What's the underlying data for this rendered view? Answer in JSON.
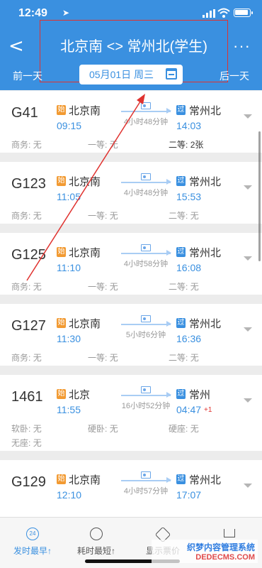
{
  "status": {
    "time": "12:49"
  },
  "header": {
    "title": "北京南 <> 常州北(学生)",
    "prev_day": "前一天",
    "next_day": "后一天",
    "date": "05月01日 周三",
    "back_glyph": "<",
    "more_glyph": "···"
  },
  "trains": [
    {
      "number": "G41",
      "from_badge": "始",
      "from": "北京南",
      "depart": "09:15",
      "duration": "4小时48分钟",
      "to_badge": "过",
      "to": "常州北",
      "arrive": "14:03",
      "plus_day": "",
      "seats": [
        {
          "label": "商务",
          "value": "无"
        },
        {
          "label": "一等",
          "value": "无"
        },
        {
          "label": "二等",
          "value": "2张"
        }
      ],
      "extra_seats": []
    },
    {
      "number": "G123",
      "from_badge": "始",
      "from": "北京南",
      "depart": "11:05",
      "duration": "4小时48分钟",
      "to_badge": "过",
      "to": "常州北",
      "arrive": "15:53",
      "plus_day": "",
      "seats": [
        {
          "label": "商务",
          "value": "无"
        },
        {
          "label": "一等",
          "value": "无"
        },
        {
          "label": "二等",
          "value": "无"
        }
      ],
      "extra_seats": []
    },
    {
      "number": "G125",
      "from_badge": "始",
      "from": "北京南",
      "depart": "11:10",
      "duration": "4小时58分钟",
      "to_badge": "过",
      "to": "常州北",
      "arrive": "16:08",
      "plus_day": "",
      "seats": [
        {
          "label": "商务",
          "value": "无"
        },
        {
          "label": "一等",
          "value": "无"
        },
        {
          "label": "二等",
          "value": "无"
        }
      ],
      "extra_seats": []
    },
    {
      "number": "G127",
      "from_badge": "始",
      "from": "北京南",
      "depart": "11:30",
      "duration": "5小时6分钟",
      "to_badge": "过",
      "to": "常州北",
      "arrive": "16:36",
      "plus_day": "",
      "seats": [
        {
          "label": "商务",
          "value": "无"
        },
        {
          "label": "一等",
          "value": "无"
        },
        {
          "label": "二等",
          "value": "无"
        }
      ],
      "extra_seats": []
    },
    {
      "number": "1461",
      "from_badge": "始",
      "from": "北京",
      "depart": "11:55",
      "duration": "16小时52分钟",
      "to_badge": "过",
      "to": "常州",
      "arrive": "04:47",
      "plus_day": "+1",
      "seats": [
        {
          "label": "软卧",
          "value": "无"
        },
        {
          "label": "硬卧",
          "value": "无"
        },
        {
          "label": "硬座",
          "value": "无"
        }
      ],
      "extra_seats": [
        {
          "label": "无座",
          "value": "无"
        }
      ]
    },
    {
      "number": "G129",
      "from_badge": "始",
      "from": "北京南",
      "depart": "12:10",
      "duration": "4小时57分钟",
      "to_badge": "过",
      "to": "常州北",
      "arrive": "17:07",
      "plus_day": "",
      "seats": [],
      "extra_seats": []
    }
  ],
  "bottom_tabs": [
    {
      "label": "发时最早↑",
      "icon": "clock-24-icon",
      "active": true
    },
    {
      "label": "耗时最短↑",
      "icon": "timer-icon",
      "active": false
    },
    {
      "label": "显示票价",
      "icon": "price-tag-icon",
      "active": false
    },
    {
      "label": "",
      "icon": "cart-icon",
      "active": false
    }
  ],
  "tab_icon_text": "24",
  "watermark": {
    "line1": "织梦内容管理系统",
    "line2": "DEDECMS.COM"
  },
  "colors": {
    "accent": "#3a90e0",
    "start_badge": "#f29a32",
    "highlight_box": "#e0322f",
    "arrow": "#e0322f"
  }
}
